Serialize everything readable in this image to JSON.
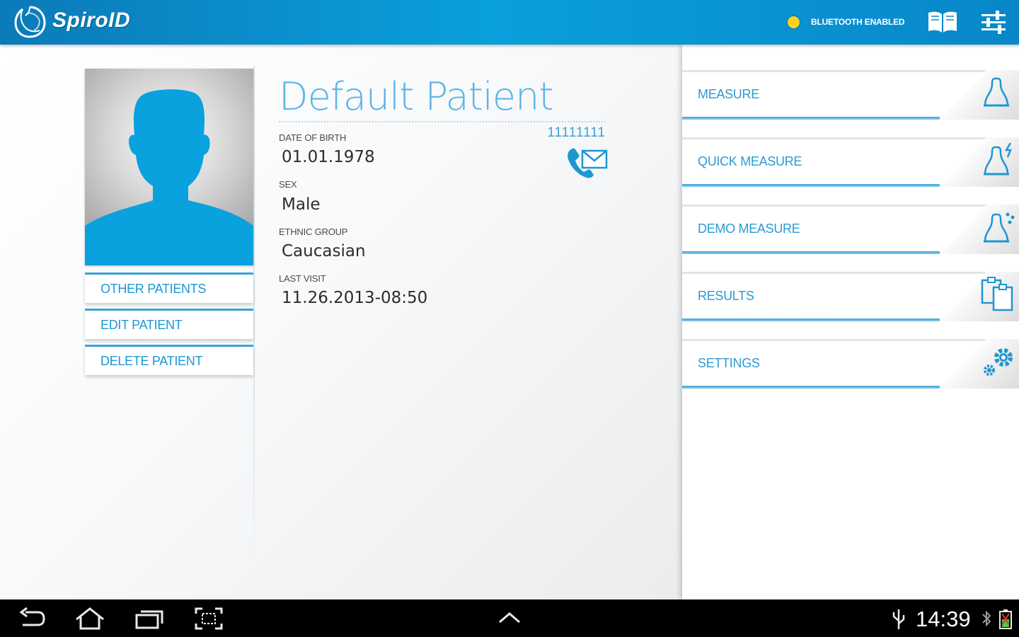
{
  "app": {
    "title": "SpiroID",
    "bluetooth_status": "BLUETOOTH ENABLED",
    "accent_color": "#1d97d3",
    "status_dot_color": "#ffd21c"
  },
  "header_icons": [
    "spiroid-logo-icon",
    "bluetooth-status-dot",
    "book-icon",
    "settings-sliders-icon"
  ],
  "patient": {
    "name": "Default Patient",
    "id": "11111111",
    "date_of_birth_label": "DATE OF BIRTH",
    "date_of_birth": "01.01.1978",
    "sex_label": "SEX",
    "sex": "Male",
    "ethnic_group_label": "ETHNIC GROUP",
    "ethnic_group": "Caucasian",
    "last_visit_label": "LAST VISIT",
    "last_visit": "11.26.2013-08:50"
  },
  "patient_actions": [
    {
      "label": "OTHER PATIENTS"
    },
    {
      "label": "EDIT PATIENT"
    },
    {
      "label": "DELETE PATIENT"
    }
  ],
  "menu": [
    {
      "label": "MEASURE",
      "icon": "bell-icon"
    },
    {
      "label": "QUICK MEASURE",
      "icon": "quick-bell-icon"
    },
    {
      "label": "DEMO MEASURE",
      "icon": "demo-bell-icon"
    },
    {
      "label": "RESULTS",
      "icon": "clipboard-icon"
    },
    {
      "label": "SETTINGS",
      "icon": "gears-icon"
    }
  ],
  "system_bar": {
    "time": "14:39",
    "icons": [
      "back-icon",
      "home-icon",
      "recent-apps-icon",
      "screenshot-icon",
      "chevron-up-icon",
      "usb-icon",
      "bluetooth-icon",
      "battery-icon"
    ]
  }
}
